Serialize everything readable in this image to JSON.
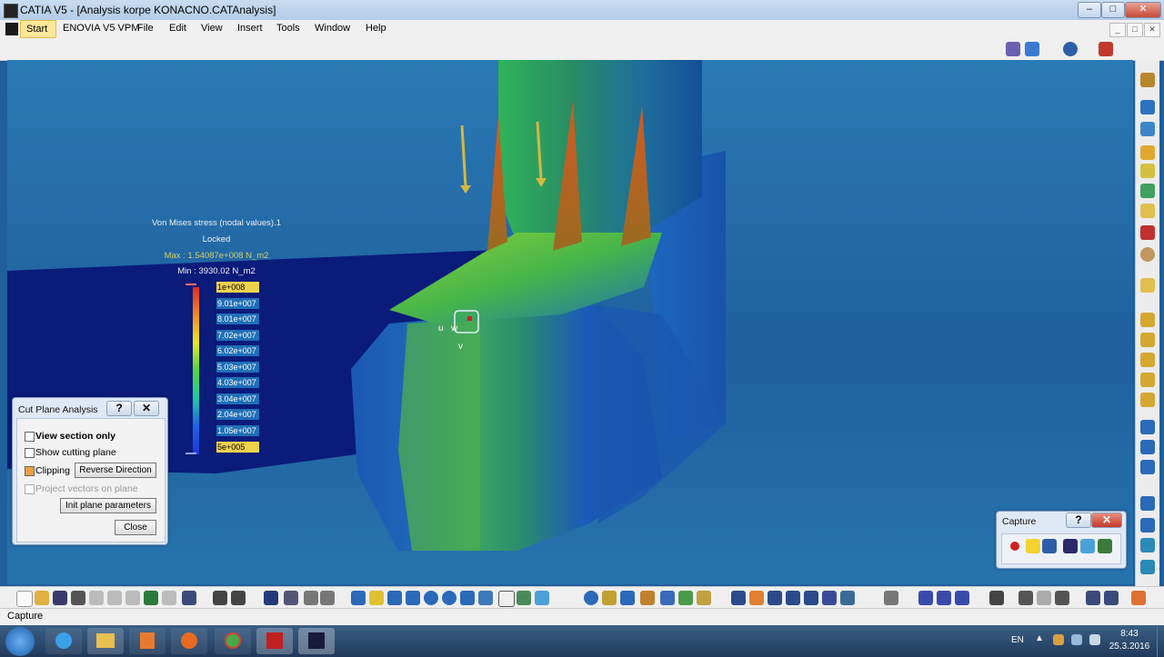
{
  "window": {
    "title": "CATIA V5 - [Analysis korpe KONACNO.CATAnalysis]",
    "min_label": "‒",
    "max_label": "□",
    "close_label": "✕"
  },
  "menu": {
    "items": [
      "Start",
      "ENOVIA V5 VPM",
      "File",
      "Edit",
      "View",
      "Insert",
      "Tools",
      "Window",
      "Help"
    ],
    "mdi_min": "_",
    "mdi_max": "□",
    "mdi_close": "✕"
  },
  "legend": {
    "title": "Von Mises stress (nodal values).1",
    "locked": "Locked",
    "max": "Max : 1.54087e+008 N_m2",
    "min": "Min : 3930.02 N_m2",
    "values": [
      "1e+008",
      "9.01e+007",
      "8.01e+007",
      "7.02e+007",
      "6.02e+007",
      "5.03e+007",
      "4.03e+007",
      "3.04e+007",
      "2.04e+007",
      "1.05e+007",
      "5e+005"
    ],
    "max_color": "#f0d24a"
  },
  "axes": {
    "u": "u",
    "w": "w",
    "v": "v"
  },
  "cut_plane": {
    "title": "Cut Plane Analysis",
    "help": "?",
    "close_x": "✕",
    "view_section": "View section only",
    "show_cutting": "Show cutting plane",
    "clipping": "Clipping",
    "reverse": "Reverse Direction",
    "project": "Project vectors on plane",
    "init": "Init plane parameters",
    "close": "Close"
  },
  "capture": {
    "title": "Capture",
    "help": "?",
    "close_x": "✕"
  },
  "statusbar": {
    "text": "Capture"
  },
  "taskbar": {
    "lang": "EN",
    "time": "8:43",
    "date": "25.3.2016"
  },
  "colors": {
    "viewport_bg": "#1f609e",
    "plate": "#0a1b7a",
    "accent": "#f0d24a"
  }
}
